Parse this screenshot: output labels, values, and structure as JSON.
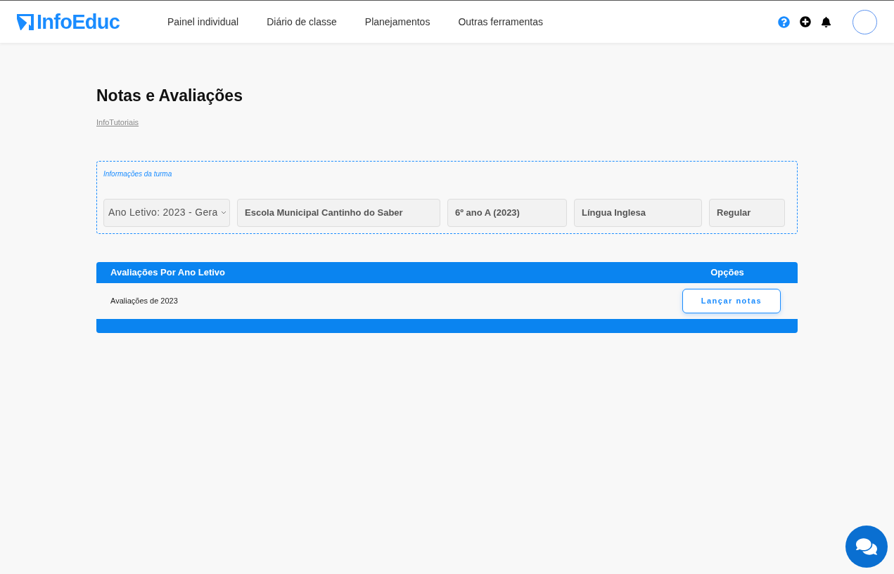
{
  "header": {
    "logo": "InfoEduc",
    "nav": [
      {
        "label": "Painel individual"
      },
      {
        "label": "Diário de classe"
      },
      {
        "label": "Planejamentos"
      },
      {
        "label": "Outras ferramentas"
      }
    ]
  },
  "page": {
    "title": "Notas e Avaliações",
    "link": "InfoTutoriais"
  },
  "class_info": {
    "legend": "Informações da turma",
    "fields": [
      {
        "kind": "select",
        "value": "Ano Letivo: 2023 - Gera"
      },
      {
        "kind": "text",
        "value": "Escola Municipal Cantinho do Saber"
      },
      {
        "kind": "text",
        "value": "6º ano A (2023)"
      },
      {
        "kind": "text",
        "value": "Língua Inglesa"
      },
      {
        "kind": "text",
        "value": "Regular"
      }
    ]
  },
  "table": {
    "columns": [
      "Avaliações Por Ano Letivo",
      "Opções"
    ],
    "rows": [
      {
        "name": "Avaliações de 2023",
        "action": "Lançar notas"
      }
    ]
  }
}
